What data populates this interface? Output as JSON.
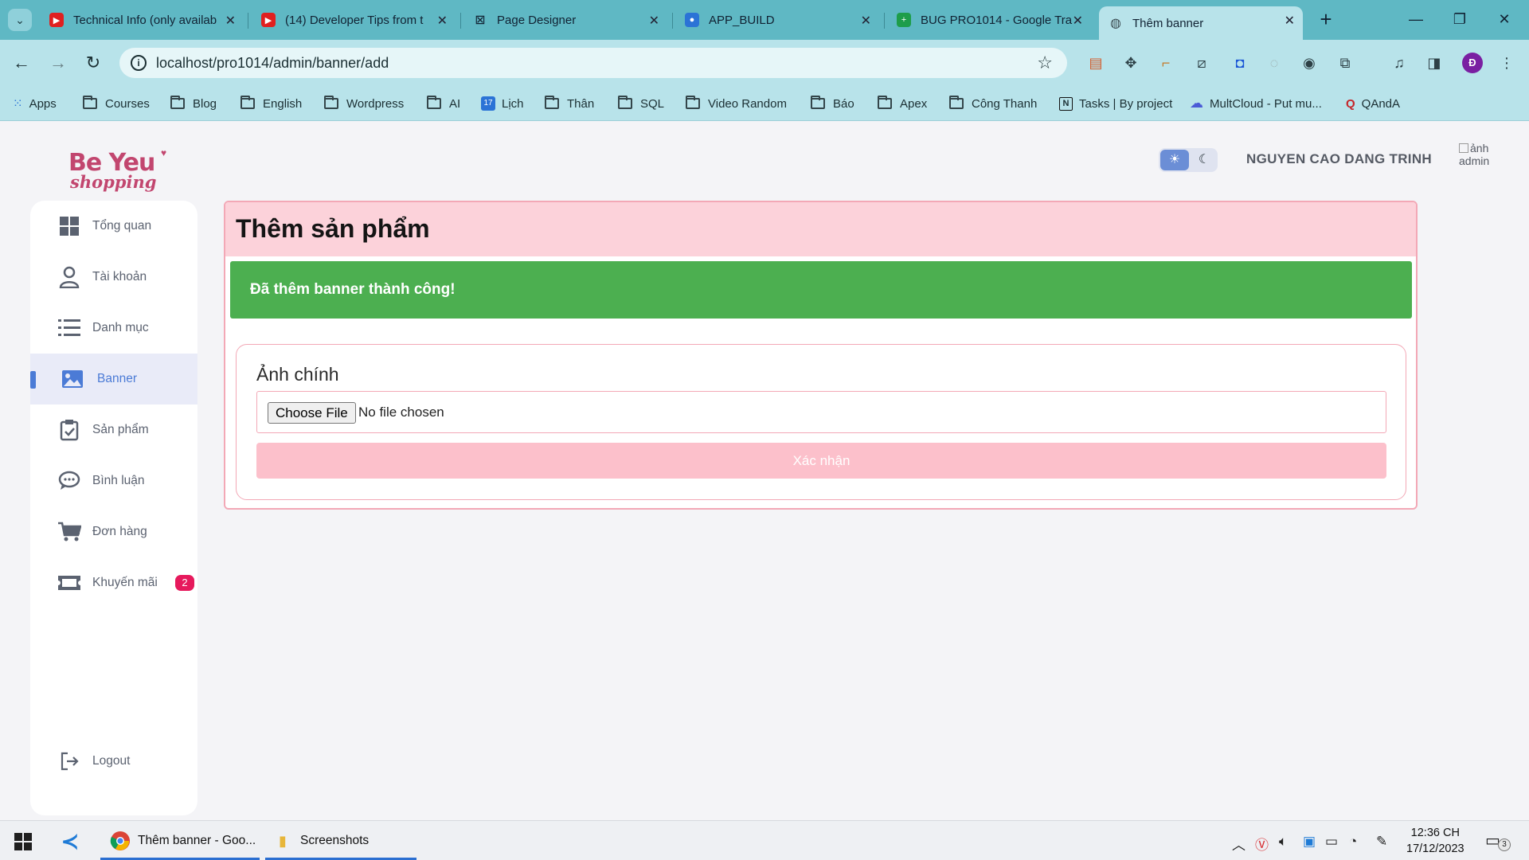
{
  "browser": {
    "tabs": [
      {
        "label": "Technical Info (only availab",
        "favicon": "youtube-icon"
      },
      {
        "label": "(14) Developer Tips from t",
        "favicon": "youtube-icon"
      },
      {
        "label": "Page Designer",
        "favicon": "page-designer-icon"
      },
      {
        "label": "APP_BUILD",
        "favicon": "app-build-icon"
      },
      {
        "label": "BUG PRO1014 - Google Tra",
        "favicon": "google-sheets-icon"
      },
      {
        "label": "Thêm banner",
        "favicon": "globe-icon"
      }
    ],
    "url": "localhost/pro1014/admin/banner/add",
    "profile_initial": "Đ",
    "bookmarks": [
      {
        "label": "Apps",
        "icon": "apps-grid-icon"
      },
      {
        "label": "Courses",
        "icon": "folder-icon"
      },
      {
        "label": "Blog",
        "icon": "folder-icon"
      },
      {
        "label": "English",
        "icon": "folder-icon"
      },
      {
        "label": "Wordpress",
        "icon": "folder-icon"
      },
      {
        "label": "AI",
        "icon": "folder-icon"
      },
      {
        "label": "Lịch",
        "icon": "calendar-icon"
      },
      {
        "label": "Thân",
        "icon": "folder-icon"
      },
      {
        "label": "SQL",
        "icon": "folder-icon"
      },
      {
        "label": "Video Random",
        "icon": "folder-icon"
      },
      {
        "label": "Báo",
        "icon": "folder-icon"
      },
      {
        "label": "Apex",
        "icon": "folder-icon"
      },
      {
        "label": "Công Thanh",
        "icon": "folder-icon"
      },
      {
        "label": "Tasks | By project",
        "icon": "notion-icon"
      },
      {
        "label": "MultCloud - Put mu...",
        "icon": "multcloud-icon"
      },
      {
        "label": "QAndA",
        "icon": "quora-icon"
      }
    ],
    "calendar_day": "17"
  },
  "app": {
    "logo_top": "Be Yeu",
    "logo_bottom": "shopping",
    "user_name": "NGUYEN CAO DANG TRINH",
    "avatar_alt": "ảnh admin",
    "sidebar": [
      {
        "label": "Tổng quan",
        "icon": "dashboard-grid-icon"
      },
      {
        "label": "Tài khoản",
        "icon": "user-icon"
      },
      {
        "label": "Danh mục",
        "icon": "list-icon"
      },
      {
        "label": "Banner",
        "icon": "image-icon",
        "active": true
      },
      {
        "label": "Sản phẩm",
        "icon": "clipboard-check-icon"
      },
      {
        "label": "Bình luận",
        "icon": "comment-icon"
      },
      {
        "label": "Đơn hàng",
        "icon": "cart-icon"
      },
      {
        "label": "Khuyến mãi",
        "icon": "ticket-icon",
        "badge": "2"
      }
    ],
    "logout_label": "Logout",
    "page_title": "Thêm sản phẩm",
    "alert_success": "Đã thêm banner thành công!",
    "form": {
      "field_label": "Ảnh chính",
      "file_button": "Choose File",
      "file_status": "No file chosen",
      "submit_label": "Xác nhận"
    },
    "colors": {
      "accent": "#4b7bd6",
      "alert_green": "#4caf50",
      "card_border": "#f3a8b6",
      "card_header": "#fcd2da",
      "submit_bg": "#fcc0cb",
      "badge": "#e6195c"
    }
  },
  "taskbar": {
    "apps": [
      {
        "label": "",
        "icon": "vscode-icon"
      },
      {
        "label": "Thêm banner - Goo...",
        "icon": "chrome-icon"
      },
      {
        "label": "Screenshots",
        "icon": "file-explorer-icon"
      }
    ],
    "time": "12:36 CH",
    "date": "17/12/2023",
    "notifications": "3"
  }
}
